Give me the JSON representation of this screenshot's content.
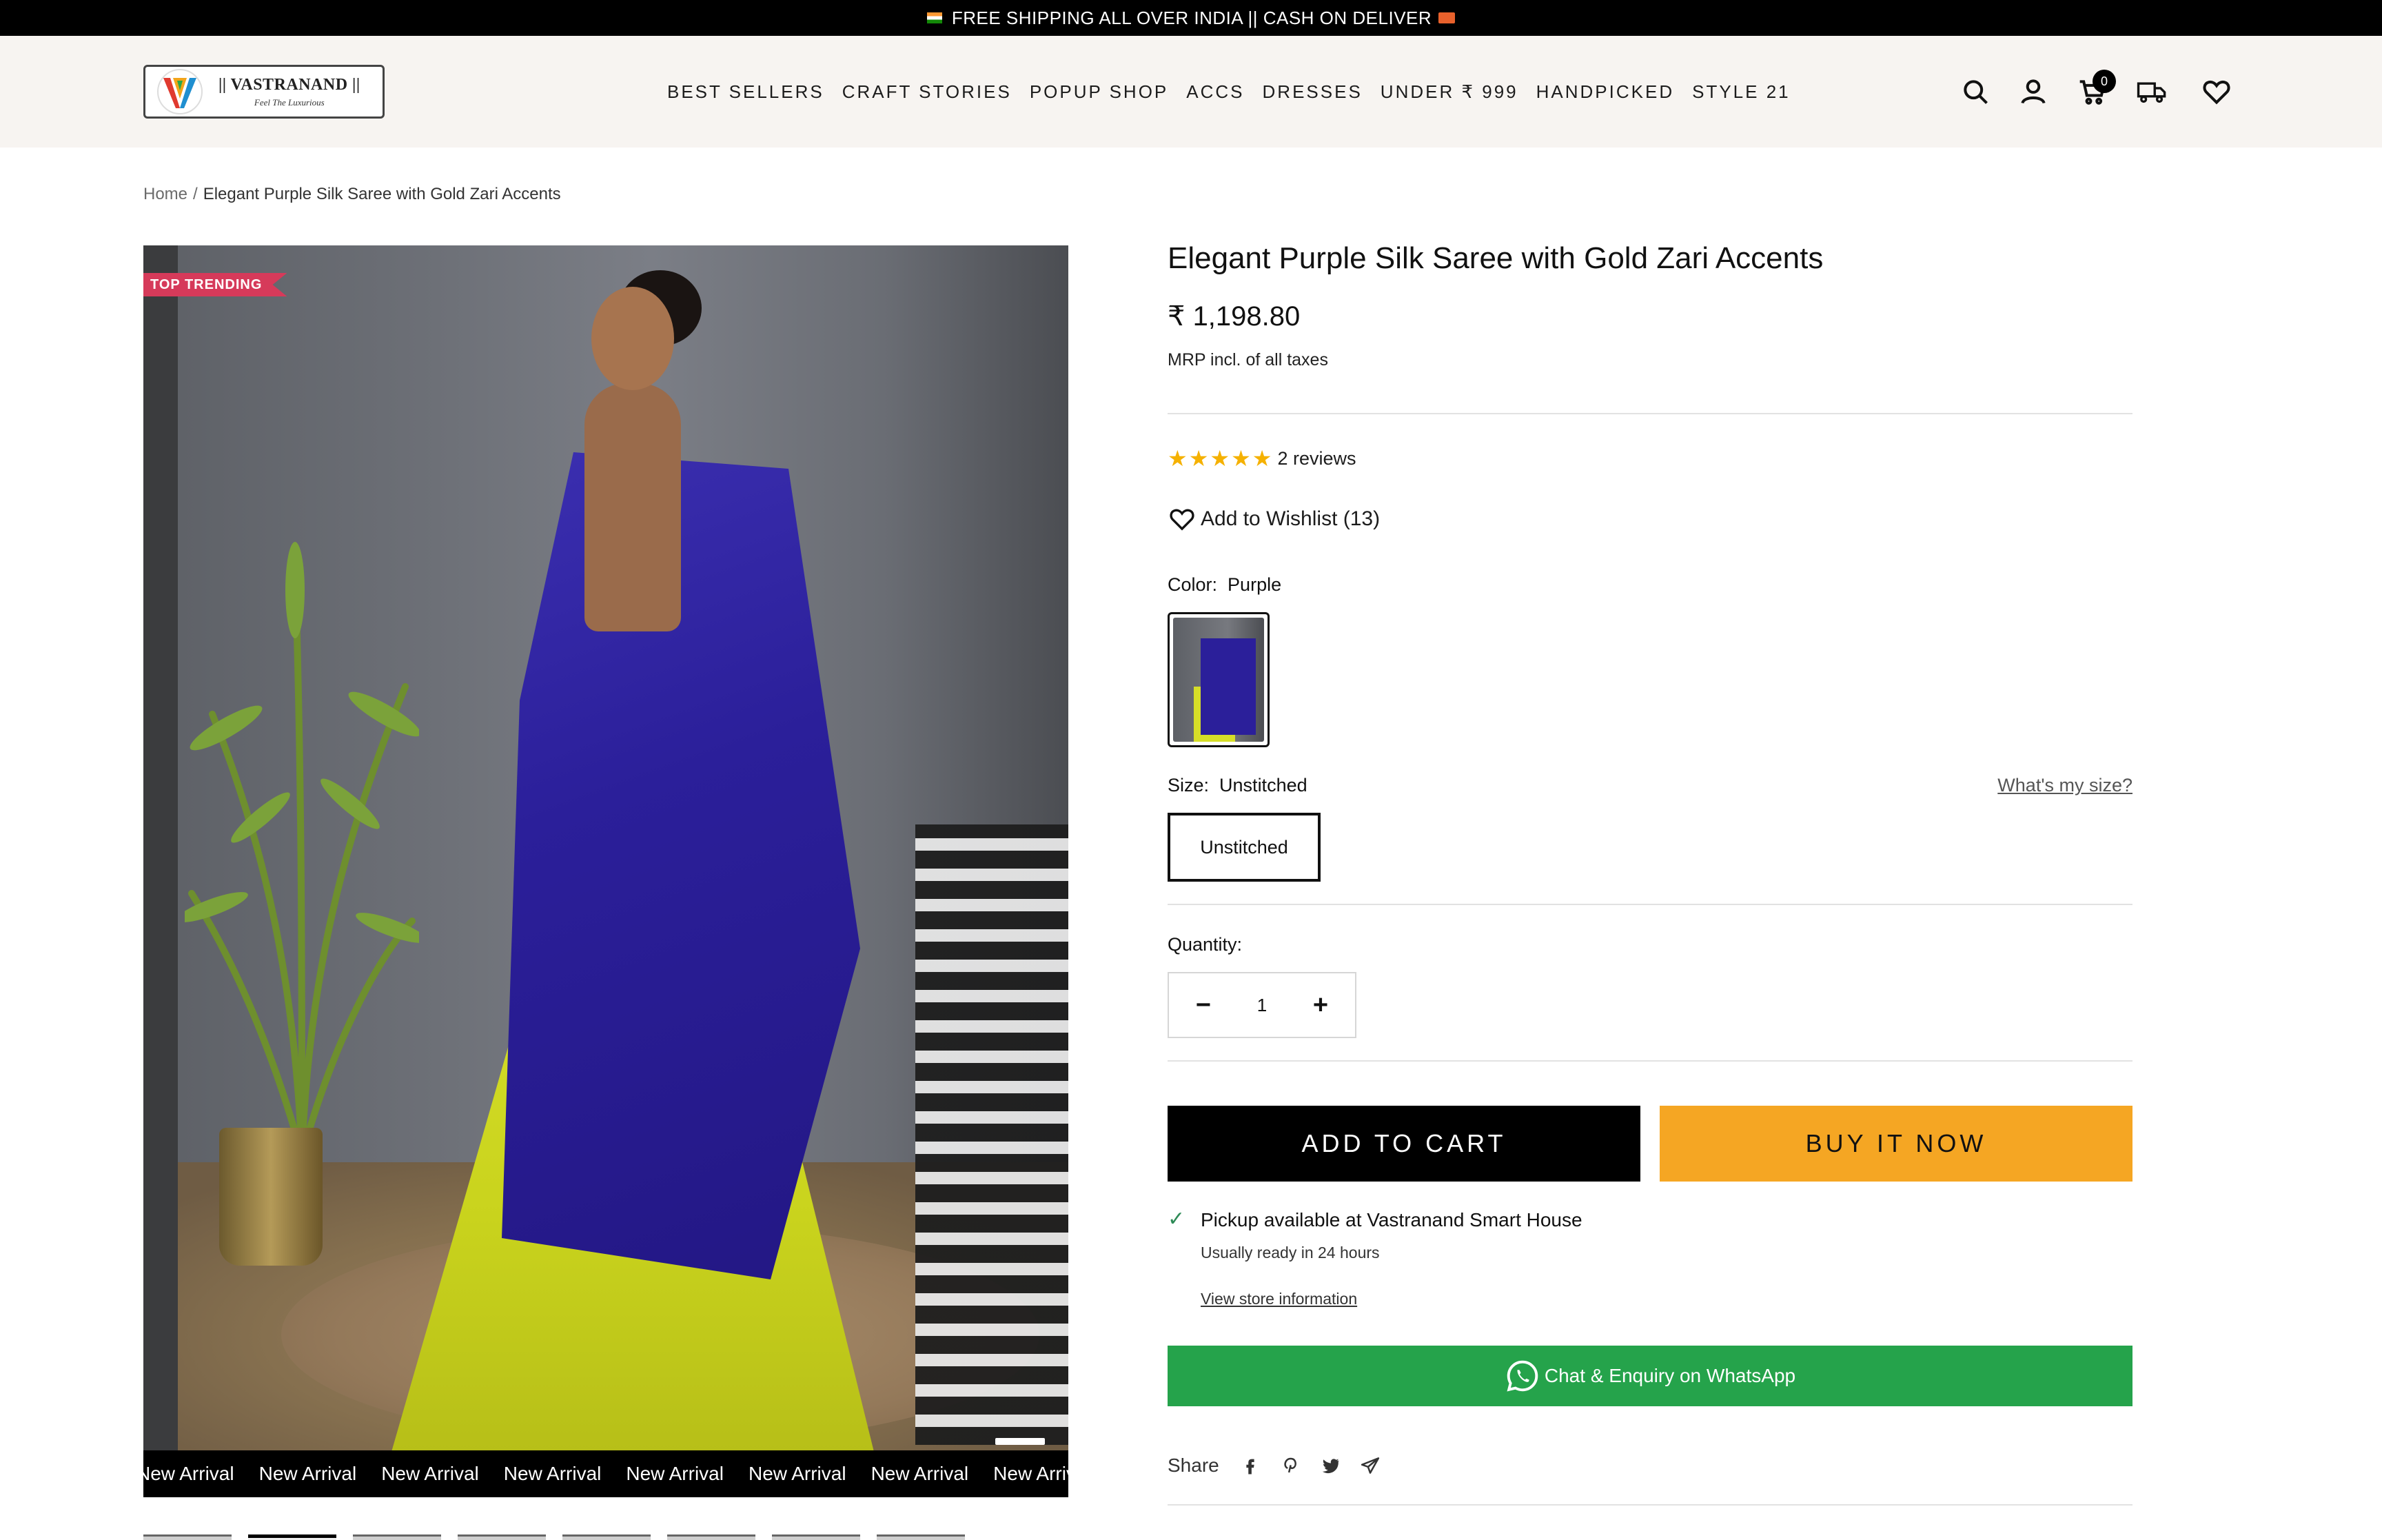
{
  "announcement": {
    "text": "FREE SHIPPING ALL OVER INDIA || CASH ON DELIVER"
  },
  "logo": {
    "name": "|| VASTRANAND ||",
    "tagline": "Feel The Luxurious"
  },
  "nav": {
    "items": [
      "BEST SELLERS",
      "CRAFT STORIES",
      "POPUP SHOP",
      "ACCS",
      "DRESSES",
      "UNDER ₹ 999",
      "HANDPICKED",
      "STYLE 21"
    ]
  },
  "header_icons": {
    "search": "search-icon",
    "account": "user-icon",
    "cart": "cart-icon",
    "cart_count": "0",
    "track": "truck-icon",
    "wishlist": "heart-icon"
  },
  "breadcrumb": {
    "home": "Home",
    "separator": "/",
    "current": "Elegant Purple Silk Saree with Gold Zari Accents"
  },
  "gallery": {
    "badge": "TOP TRENDING",
    "marquee": [
      "New Arrival",
      "New Arrival",
      "New Arrival",
      "New Arrival",
      "New Arrival",
      "New Arrival",
      "New Arrival",
      "New Arrival",
      "Ne"
    ]
  },
  "product": {
    "title": "Elegant Purple Silk Saree with Gold Zari Accents",
    "price": "₹ 1,198.80",
    "tax_note": "MRP incl. of all taxes",
    "rating": 5,
    "reviews": "2 reviews",
    "wishlist": "Add to Wishlist (13)",
    "color_label": "Color:",
    "color_value": "Purple",
    "size_label": "Size:",
    "size_value": "Unstitched",
    "size_help": "What's my size?",
    "size_option": "Unstitched",
    "quantity_label": "Quantity:",
    "quantity": "1",
    "add_to_cart": "ADD TO CART",
    "buy_now": "BUY IT NOW",
    "pickup_title": "Pickup available at Vastranand Smart House",
    "pickup_sub": "Usually ready in 24 hours",
    "pickup_link": "View store information",
    "whatsapp": "Chat & Enquiry on WhatsApp",
    "share_label": "Share"
  },
  "colors": {
    "accent_buy": "#f5a623",
    "whatsapp": "#25a34b",
    "badge": "#d63a5a",
    "star": "#f5b100"
  }
}
